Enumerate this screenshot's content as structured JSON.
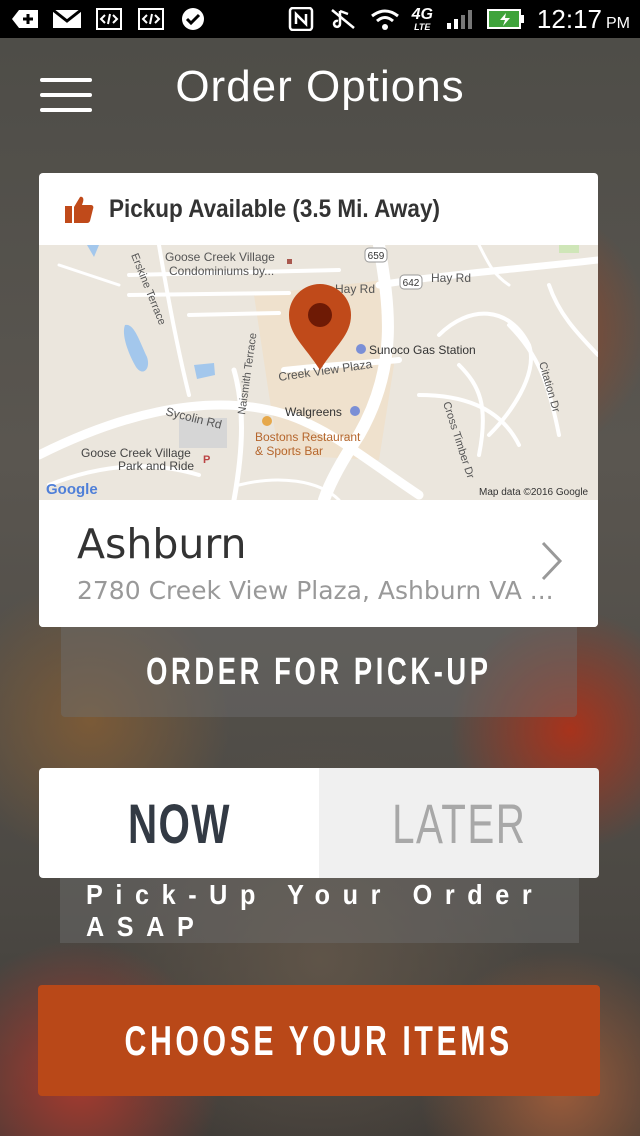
{
  "status_bar": {
    "time": "12:17",
    "ampm": "PM",
    "network": "4G",
    "network_sub": "LTE",
    "icons": [
      "add-icon",
      "gmail-icon",
      "code-icon",
      "code-icon",
      "check-bubble-icon",
      "nfc-icon",
      "mute-icon",
      "wifi-icon",
      "signal-icon",
      "battery-charging-icon"
    ]
  },
  "header": {
    "title": "Order Options",
    "menu_icon": "hamburger-menu-icon"
  },
  "store_card": {
    "pickup_text": "Pickup Available (3.5 Mi. Away)",
    "pickup_icon": "thumbs-up-icon",
    "map": {
      "labels": {
        "goose_creek_condos_1": "Goose Creek Village",
        "goose_creek_condos_2": "Condominiums by...",
        "erskine": "Erskine Terrace",
        "hay_rd": "Hay Rd",
        "hay_rd_2": "Hay Rd",
        "route_659": "659",
        "route_642": "642",
        "sunoco": "Sunoco Gas Station",
        "creek_view": "Creek View Plaza",
        "naismith": "Naismith Terrace",
        "sycolin": "Sycolin Rd",
        "walgreens": "Walgreens",
        "bostons_1": "Bostons Restaurant",
        "bostons_2": "& Sports Bar",
        "park_ride_1": "Goose Creek Village",
        "park_ride_2": "Park and Ride",
        "cross_timber": "Cross Timber Dr",
        "citation": "Citation Dr",
        "google": "Google",
        "map_data": "Map data ©2016 Google"
      },
      "pin_color": "#c04a1a"
    },
    "store_name": "Ashburn",
    "store_address": "2780 Creek View Plaza, Ashburn VA ..."
  },
  "order_type_label": "ORDER FOR PICK-UP",
  "time_toggle": {
    "now_label": "NOW",
    "later_label": "LATER",
    "selected": "NOW"
  },
  "asap_text": "Pick-Up Your Order ASAP",
  "choose_button": "CHOOSE YOUR ITEMS",
  "colors": {
    "accent": "#b94818",
    "text_dark": "#333a44"
  }
}
